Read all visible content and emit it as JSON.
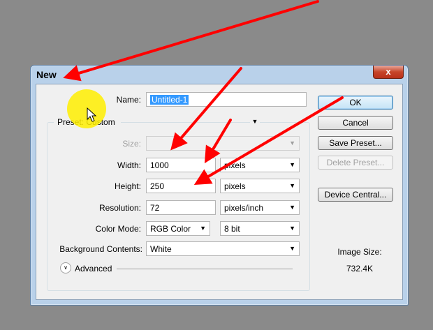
{
  "dialog": {
    "title": "New",
    "close_glyph": "x",
    "name_label": "Name:",
    "name_value": "Untitled-1",
    "preset_label": "Preset:",
    "preset_value": "Custom",
    "size_label": "Size:",
    "size_value": "",
    "width_label": "Width:",
    "width_value": "1000",
    "width_unit": "pixels",
    "height_label": "Height:",
    "height_value": "250",
    "height_unit": "pixels",
    "resolution_label": "Resolution:",
    "resolution_value": "72",
    "resolution_unit": "pixels/inch",
    "color_mode_label": "Color Mode:",
    "color_mode_value": "RGB Color",
    "bit_depth_value": "8 bit",
    "background_label": "Background Contents:",
    "background_value": "White",
    "advanced_label": "Advanced",
    "image_size_label": "Image Size:",
    "image_size_value": "732.4K"
  },
  "buttons": {
    "ok": "OK",
    "cancel": "Cancel",
    "save_preset": "Save Preset...",
    "delete_preset": "Delete Preset...",
    "device_central": "Device Central..."
  },
  "icons": {
    "dropdown": "chevron-down-icon",
    "advanced_toggle": "double-chevron-down-icon",
    "cursor": "mouse-pointer-icon",
    "annotations": "red-arrow-icon"
  },
  "colors": {
    "selection": "#3399ff",
    "highlight": "#ffee00",
    "annotation": "#ff0000",
    "title_bar": "#b9d1ea",
    "close_button": "#c7452a"
  }
}
